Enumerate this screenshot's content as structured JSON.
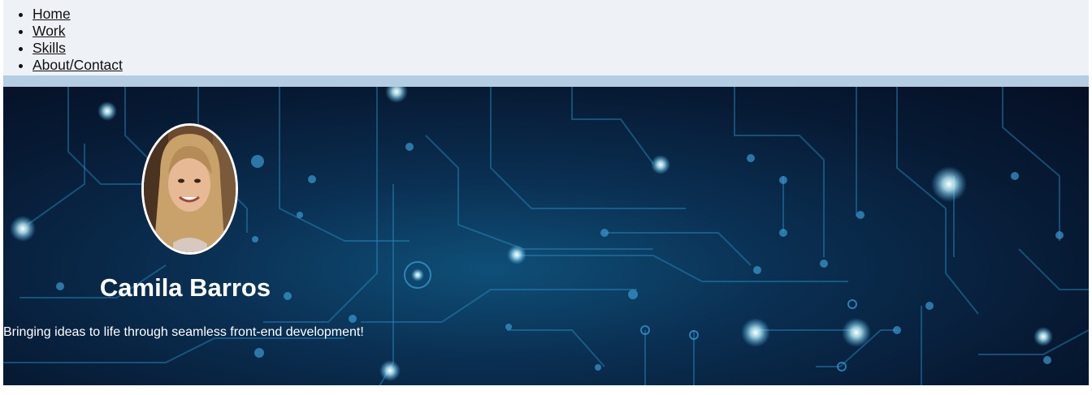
{
  "nav": {
    "items": [
      {
        "label": "Home"
      },
      {
        "label": "Work"
      },
      {
        "label": "Skills"
      },
      {
        "label": "About/Contact"
      }
    ]
  },
  "hero": {
    "name": "Camila Barros",
    "tagline": "Bringing ideas to life through seamless front-end development!",
    "background": "circuit-board-image",
    "avatar": "profile-photo"
  },
  "colors": {
    "nav_bg": "#eef2f7",
    "divider": "#b5cde3",
    "hero_bg": "#0a2f52",
    "text_on_hero": "#ffffff"
  }
}
